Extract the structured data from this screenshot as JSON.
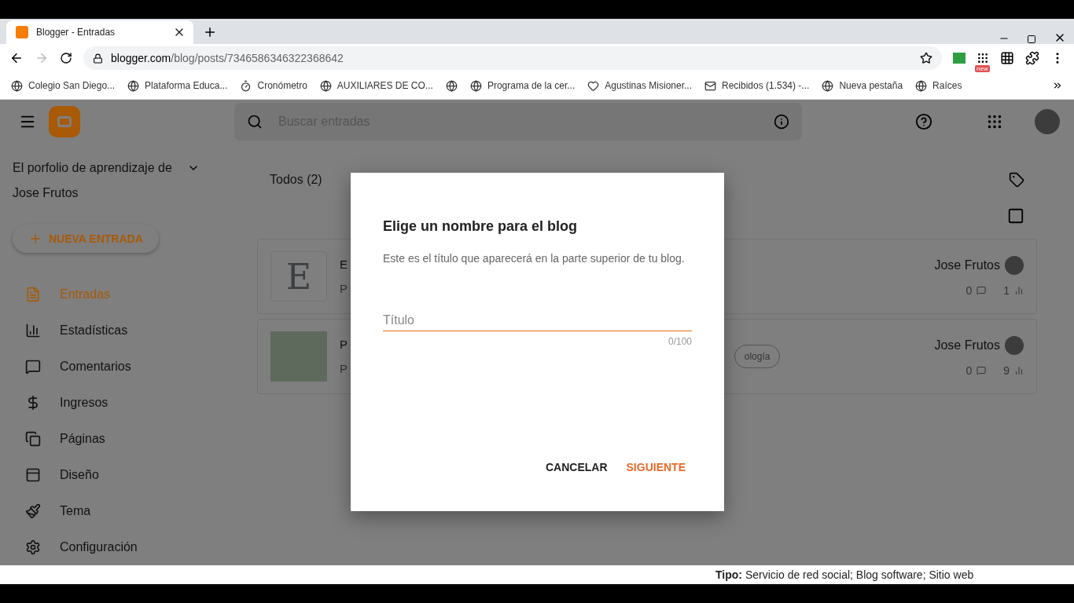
{
  "browser": {
    "tab": {
      "title": "Blogger - Entradas"
    },
    "url": {
      "host": "blogger.com",
      "path": "/blog/posts/7346586346322368642"
    },
    "extension_badge": "new",
    "bookmarks": [
      {
        "label": "Colegio San Diego..."
      },
      {
        "label": "Plataforma Educa..."
      },
      {
        "label": "Cronómetro"
      },
      {
        "label": "AUXILIARES DE CO..."
      },
      {
        "kind": "icon"
      },
      {
        "label": "Programa de la cer..."
      },
      {
        "label": "Agustinas Misioner..."
      },
      {
        "label": "Recibidos (1.534) -..."
      },
      {
        "label": "Nueva pestaña"
      },
      {
        "label": "Raíces"
      }
    ]
  },
  "header": {
    "search": {
      "placeholder": "Buscar entradas"
    }
  },
  "sidebar": {
    "blog_title": "El porfolio de aprendizaje de Jose Frutos",
    "new_post": "NUEVA ENTRADA",
    "items": [
      {
        "label": "Entradas",
        "selected": true
      },
      {
        "label": "Estadísticas",
        "selected": false
      },
      {
        "label": "Comentarios",
        "selected": false
      },
      {
        "label": "Ingresos",
        "selected": false
      },
      {
        "label": "Páginas",
        "selected": false
      },
      {
        "label": "Diseño",
        "selected": false
      },
      {
        "label": "Tema",
        "selected": false
      },
      {
        "label": "Configuración",
        "selected": false
      }
    ]
  },
  "filter": {
    "label": "Todos (2)"
  },
  "select_all": {
    "checked": false
  },
  "posts": [
    {
      "kind": "letter",
      "thumb": "E",
      "title": "E",
      "status": "P",
      "author": "Jose Frutos",
      "comments": "0",
      "views": "1"
    },
    {
      "kind": "photo",
      "title": "P",
      "status": "P",
      "tag": "ología",
      "author": "Jose Frutos",
      "comments": "0",
      "views": "9"
    }
  ],
  "dialog": {
    "title": "Elige un nombre para el blog",
    "description": "Este es el título que aparecerá en la parte superior de tu blog.",
    "field": {
      "placeholder": "Título",
      "counter": "0/100"
    },
    "buttons": [
      {
        "label": "CANCELAR",
        "kind": "plain"
      },
      {
        "label": "SIGUIENTE",
        "kind": "primary"
      }
    ]
  },
  "background_window": {
    "label": "Tipo:",
    "text": "Servicio de red social; Blog software; Sitio web"
  }
}
